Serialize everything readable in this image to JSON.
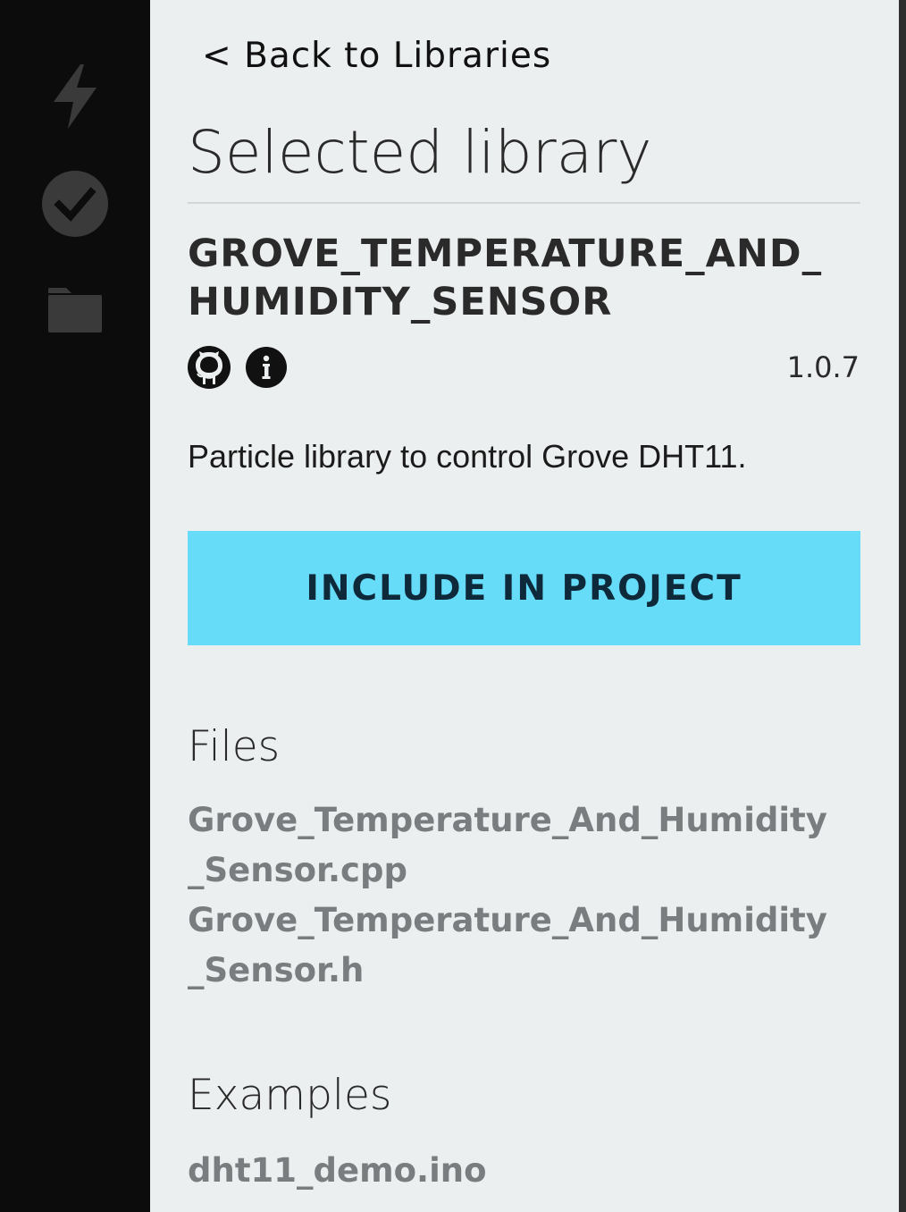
{
  "sidebar": {
    "items": [
      {
        "icon": "lightning-icon"
      },
      {
        "icon": "check-circle-icon"
      },
      {
        "icon": "folder-icon"
      }
    ]
  },
  "panel": {
    "back_link": "< Back to Libraries",
    "title": "Selected library",
    "library": {
      "name_line1": "GROVE_TEMPERATURE_AND_",
      "name_line2": "HUMIDITY_SENSOR",
      "version": "1.0.7",
      "description": "Particle library to control Grove DHT11.",
      "links": [
        {
          "icon": "github-icon"
        },
        {
          "icon": "info-icon"
        }
      ]
    },
    "include_button": "INCLUDE IN PROJECT",
    "files_title": "Files",
    "files": [
      {
        "line1": "Grove_Temperature_And_Humidity",
        "line2": "_Sensor.cpp"
      },
      {
        "line1": "Grove_Temperature_And_Humidity",
        "line2": "_Sensor.h"
      }
    ],
    "examples_title": "Examples",
    "examples": [
      "dht11_demo.ino"
    ]
  },
  "colors": {
    "sidebar_bg": "#0c0c0c",
    "panel_bg": "#eceff0",
    "accent": "#66dcf9",
    "muted_text": "#7a7d7f",
    "icon_gray": "#3a3a3a"
  }
}
